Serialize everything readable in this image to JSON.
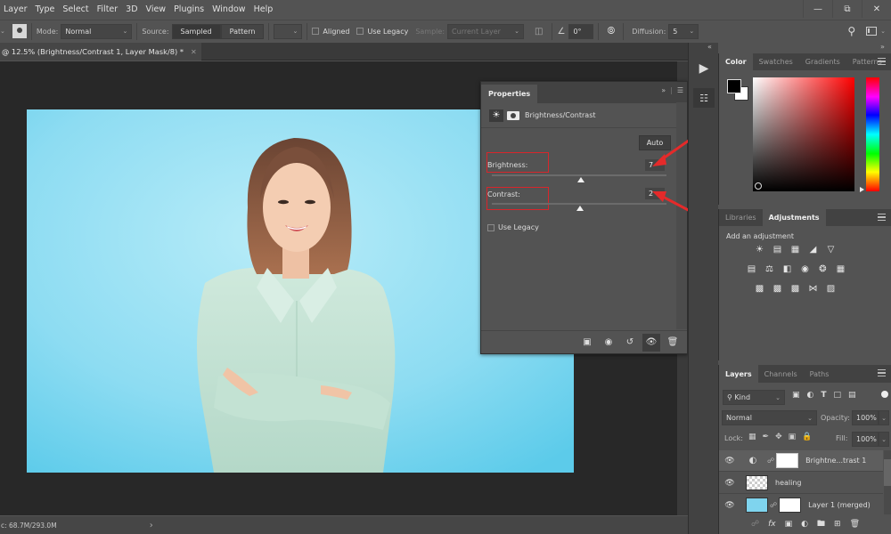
{
  "menubar": {
    "items": [
      "Layer",
      "Type",
      "Select",
      "Filter",
      "3D",
      "View",
      "Plugins",
      "Window",
      "Help"
    ],
    "window_controls": [
      "minimize",
      "restore",
      "close"
    ]
  },
  "options_bar": {
    "mode_label": "Mode:",
    "mode_value": "Normal",
    "source_label": "Source:",
    "source_options": [
      "Sampled",
      "Pattern"
    ],
    "source_selected": "Sampled",
    "aligned_label": "Aligned",
    "aligned_checked": false,
    "use_legacy_label": "Use Legacy",
    "use_legacy_checked": false,
    "sample_label": "Sample:",
    "sample_value": "Current Layer",
    "angle_value": "0°",
    "diffusion_label": "Diffusion:",
    "diffusion_value": "5"
  },
  "document": {
    "tab_title": "@ 12.5% (Brightness/Contrast 1, Layer Mask/8) *",
    "status_text": "c: 68.7M/293.0M"
  },
  "properties_panel": {
    "tab": "Properties",
    "adjustment_title": "Brightness/Contrast",
    "auto_label": "Auto",
    "brightness_label": "Brightness:",
    "brightness_value": "7",
    "contrast_label": "Contrast:",
    "contrast_value": "2",
    "brightness_slider_fraction": 0.51,
    "contrast_slider_fraction": 0.505,
    "use_legacy_label": "Use Legacy",
    "use_legacy_checked": false,
    "annotation_color": "#d9252b"
  },
  "color_panel": {
    "tabs": [
      "Color",
      "Swatches",
      "Gradients",
      "Patterns"
    ],
    "active_tab": "Color",
    "foreground": "#000000",
    "background": "#ffffff",
    "hue_color": "#ff0000"
  },
  "adjustments_panel": {
    "tabs": [
      "Libraries",
      "Adjustments"
    ],
    "active_tab": "Adjustments",
    "heading": "Add an adjustment",
    "icons_row1": [
      "brightness-contrast",
      "levels",
      "curves",
      "exposure",
      "vibrance"
    ],
    "icons_row2": [
      "hue-saturation",
      "color-balance",
      "black-white",
      "photo-filter",
      "channel-mixer",
      "color-lookup"
    ],
    "icons_row3": [
      "invert",
      "posterize",
      "threshold",
      "selective-color",
      "gradient-map"
    ]
  },
  "layers_panel": {
    "tabs": [
      "Layers",
      "Channels",
      "Paths"
    ],
    "active_tab": "Layers",
    "filter_value": "Kind",
    "blend_mode": "Normal",
    "opacity_label": "Opacity:",
    "opacity_value": "100%",
    "lock_label": "Lock:",
    "fill_label": "Fill:",
    "fill_value": "100%",
    "layers": [
      {
        "name": "Brightne...trast 1",
        "type": "adjustment",
        "selected": true,
        "visible": true
      },
      {
        "name": "healing",
        "type": "transparent",
        "selected": false,
        "visible": true
      },
      {
        "name": "Layer 1 (merged)",
        "type": "image",
        "selected": false,
        "visible": true
      }
    ]
  }
}
